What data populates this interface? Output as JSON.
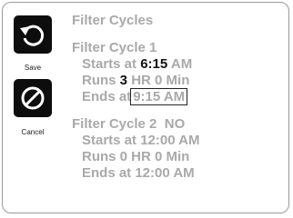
{
  "sidebar": {
    "save": {
      "label": "Save",
      "icon": "undo-arrow-icon"
    },
    "cancel": {
      "label": "Cancel",
      "icon": "no-entry-icon"
    }
  },
  "content": {
    "title": "Filter Cycles",
    "cycle1": {
      "heading": "Filter Cycle 1",
      "starts_prefix": "Starts at",
      "starts_time": "6:15",
      "starts_ampm": "AM",
      "runs_prefix": "Runs",
      "runs_hours": "3",
      "runs_suffix": "HR 0 Min",
      "ends_prefix": "Ends at",
      "ends_value": "9:15 AM"
    },
    "cycle2": {
      "heading": "Filter Cycle 2",
      "status": "NO",
      "starts": "Starts at 12:00 AM",
      "runs": "Runs 0 HR 0 Min",
      "ends": "Ends at 12:00 AM"
    }
  },
  "colors": {
    "text_muted": "#a9a9a9",
    "text_dark": "#111111",
    "button_bg": "#0d0d0d"
  }
}
